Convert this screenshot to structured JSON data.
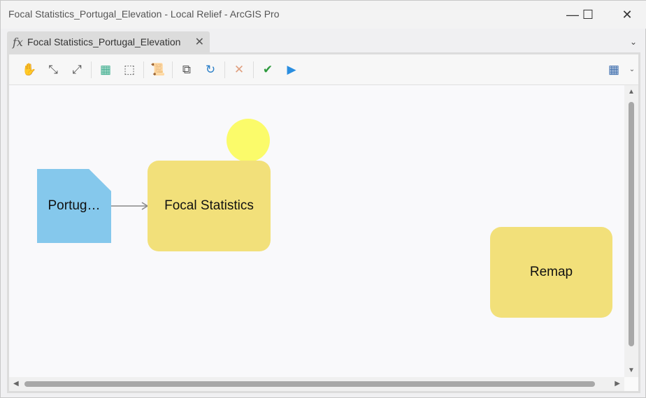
{
  "window": {
    "title": "Focal Statistics_Portugal_Elevation - Local Relief - ArcGIS Pro"
  },
  "tab": {
    "label": "Focal Statistics_Portugal_Elevation"
  },
  "nodes": {
    "input": "Portug…",
    "tool1": "Focal Statistics",
    "tool2": "Remap"
  }
}
